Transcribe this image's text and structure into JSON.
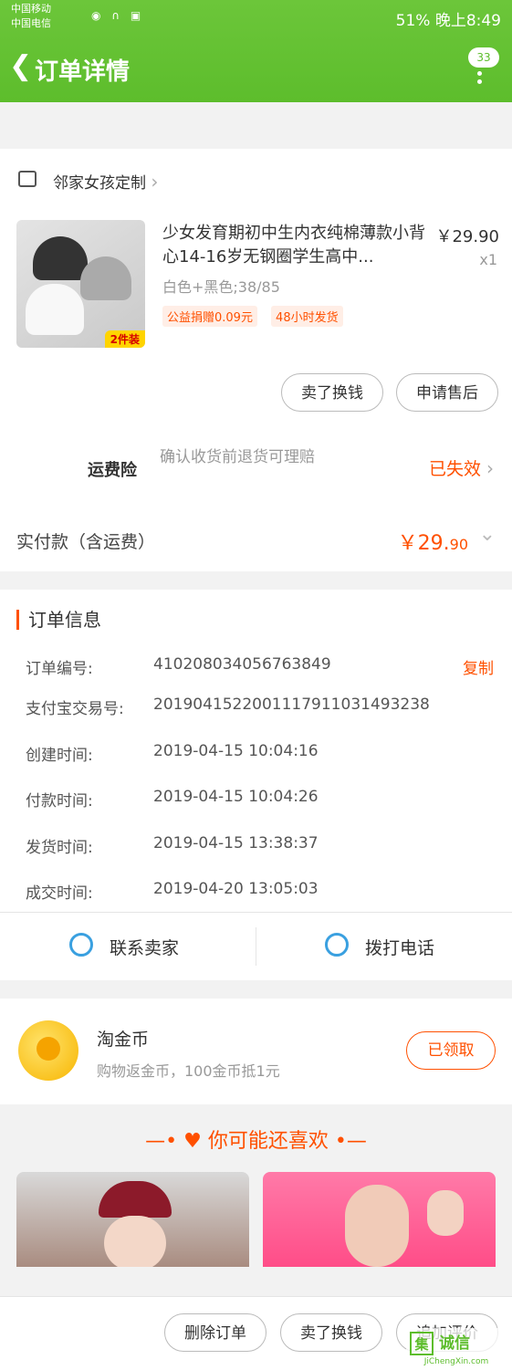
{
  "status_bar": {
    "carrier1": "中国移动",
    "carrier2": "中国电信",
    "right": "51%  晚上8:49"
  },
  "header": {
    "title": "订单详情",
    "badge": "33"
  },
  "shop": {
    "name": "邻家女孩定制"
  },
  "product": {
    "title": "少女发育期初中生内衣纯棉薄款小背心14-16岁无钢圈学生高中...",
    "price": "￥29.90",
    "qty": "x1",
    "sku": "白色+黑色;38/85",
    "tags": [
      "公益捐赠0.09元",
      "48小时发货"
    ],
    "image_tag": "2件装",
    "buttons": [
      "卖了换钱",
      "申请售后"
    ]
  },
  "insurance": {
    "label": "运费险",
    "desc": "确认收货前退货可理赔",
    "status": "已失效"
  },
  "payment": {
    "label": "实付款（含运费）",
    "amount_main": "￥29.",
    "amount_cents": "90"
  },
  "order_info": {
    "title": "订单信息",
    "copy_label": "复制",
    "rows": [
      {
        "label": "订单编号:",
        "value": "410208034056763849"
      },
      {
        "label": "支付宝交易号:",
        "value": "2019041522001117911031493238"
      },
      {
        "label": "创建时间:",
        "value": "2019-04-15 10:04:16"
      },
      {
        "label": "付款时间:",
        "value": "2019-04-15 10:04:26"
      },
      {
        "label": "发货时间:",
        "value": "2019-04-15 13:38:37"
      },
      {
        "label": "成交时间:",
        "value": "2019-04-20 13:05:03"
      }
    ]
  },
  "actions": {
    "contact": "联系卖家",
    "call": "拨打电话"
  },
  "gold": {
    "title": "淘金币",
    "desc": "购物返金币，100金币抵1元",
    "button": "已领取"
  },
  "recommend": {
    "title": "你可能还喜欢"
  },
  "bottom_bar": {
    "buttons": [
      "删除订单",
      "卖了换钱",
      "追加评价"
    ]
  },
  "watermark": {
    "cn": "诚信",
    "en": "JiChengXin.com",
    "box": "集"
  }
}
